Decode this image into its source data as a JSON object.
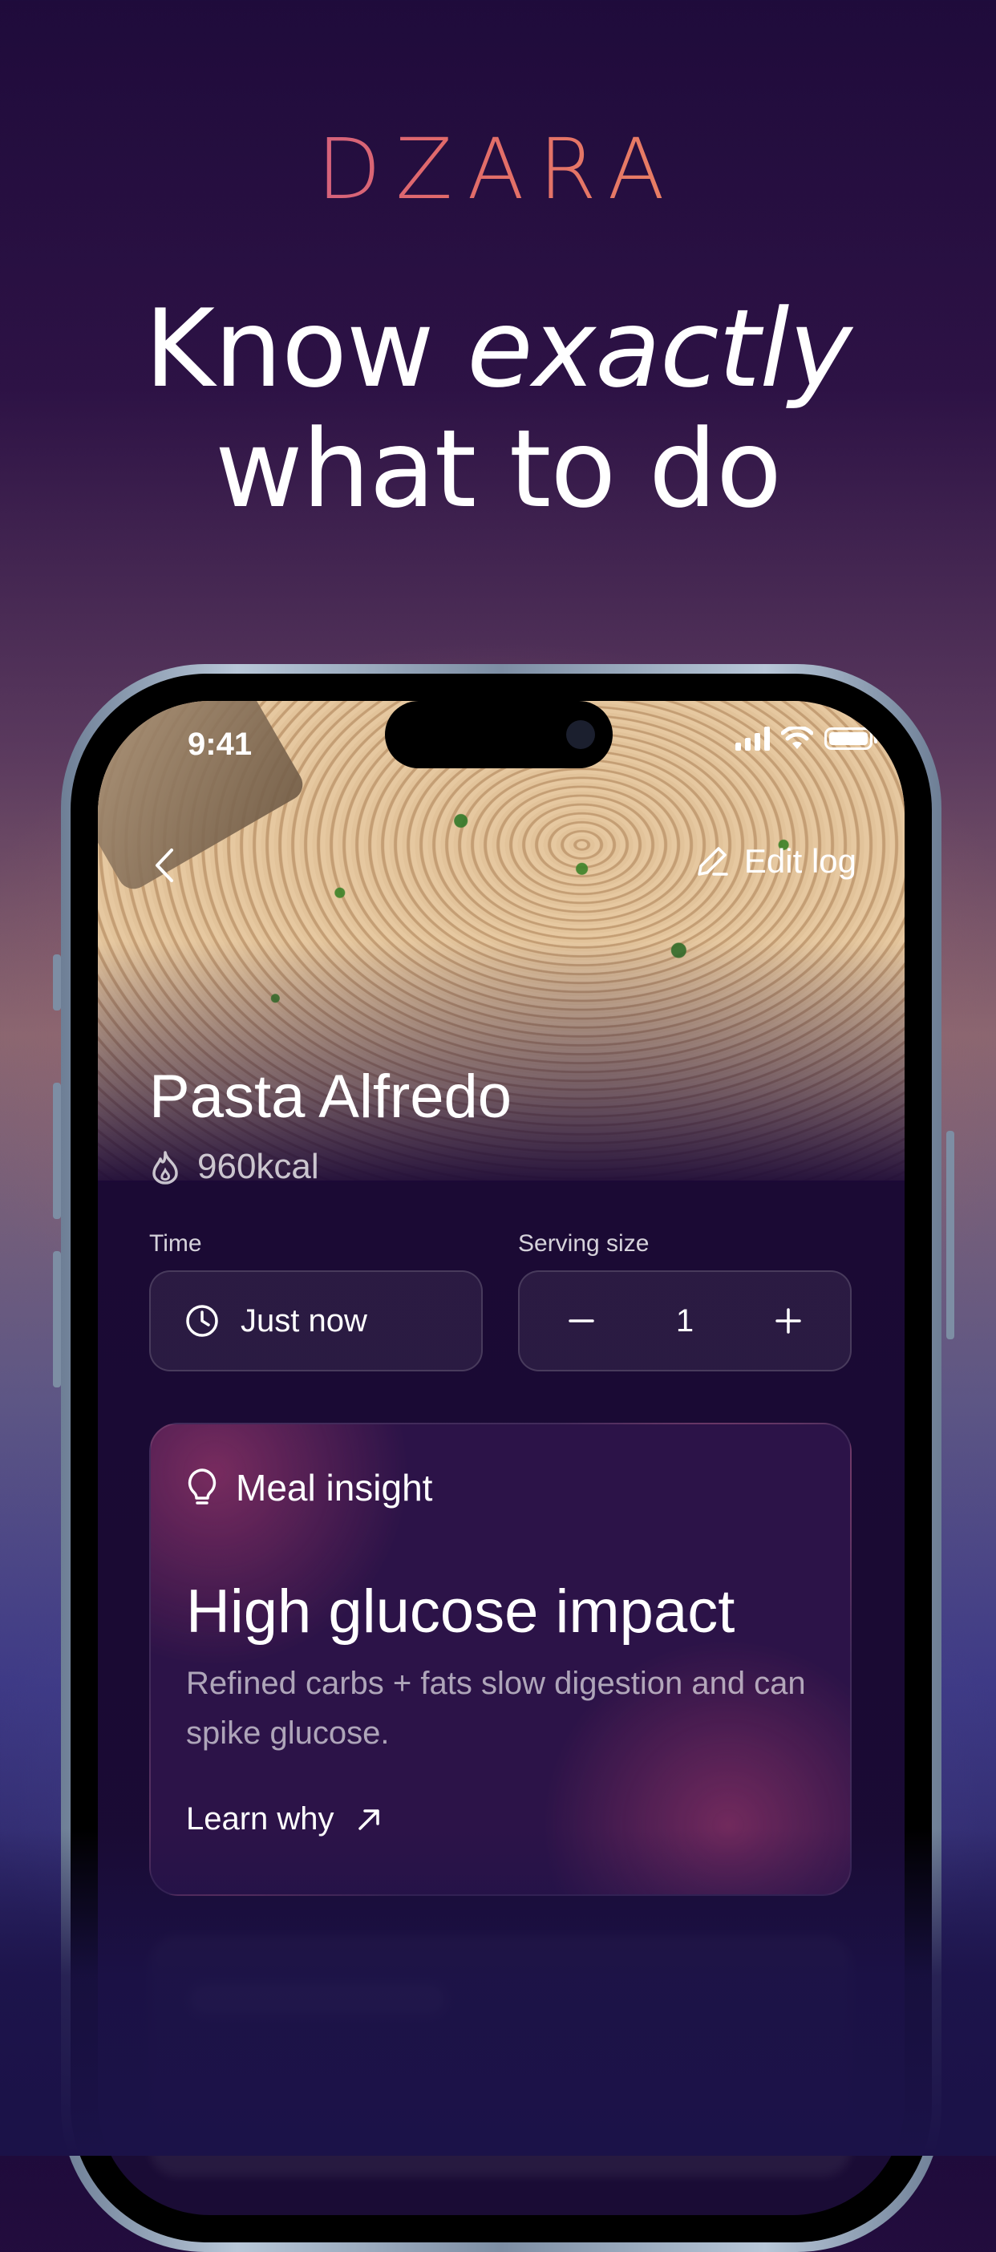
{
  "brand": {
    "logo": "DZARA"
  },
  "headline": {
    "part1": "Know",
    "part2": "exactly",
    "part3": "what to do"
  },
  "status_bar": {
    "time": "9:41"
  },
  "nav": {
    "edit_label": "Edit log"
  },
  "meal": {
    "title": "Pasta Alfredo",
    "calories": "960kcal"
  },
  "time_field": {
    "label": "Time",
    "value": "Just now"
  },
  "serving_field": {
    "label": "Serving size",
    "value": "1"
  },
  "insight": {
    "header": "Meal insight",
    "title": "High glucose impact",
    "body": "Refined carbs + fats slow digestion and can spike glucose.",
    "link": "Learn why"
  },
  "colors": {
    "accent_pink": "#e16a6a",
    "accent_orange": "#f29a5c",
    "accent_magenta": "#b64ea8",
    "screen_bg": "#1c0936"
  }
}
